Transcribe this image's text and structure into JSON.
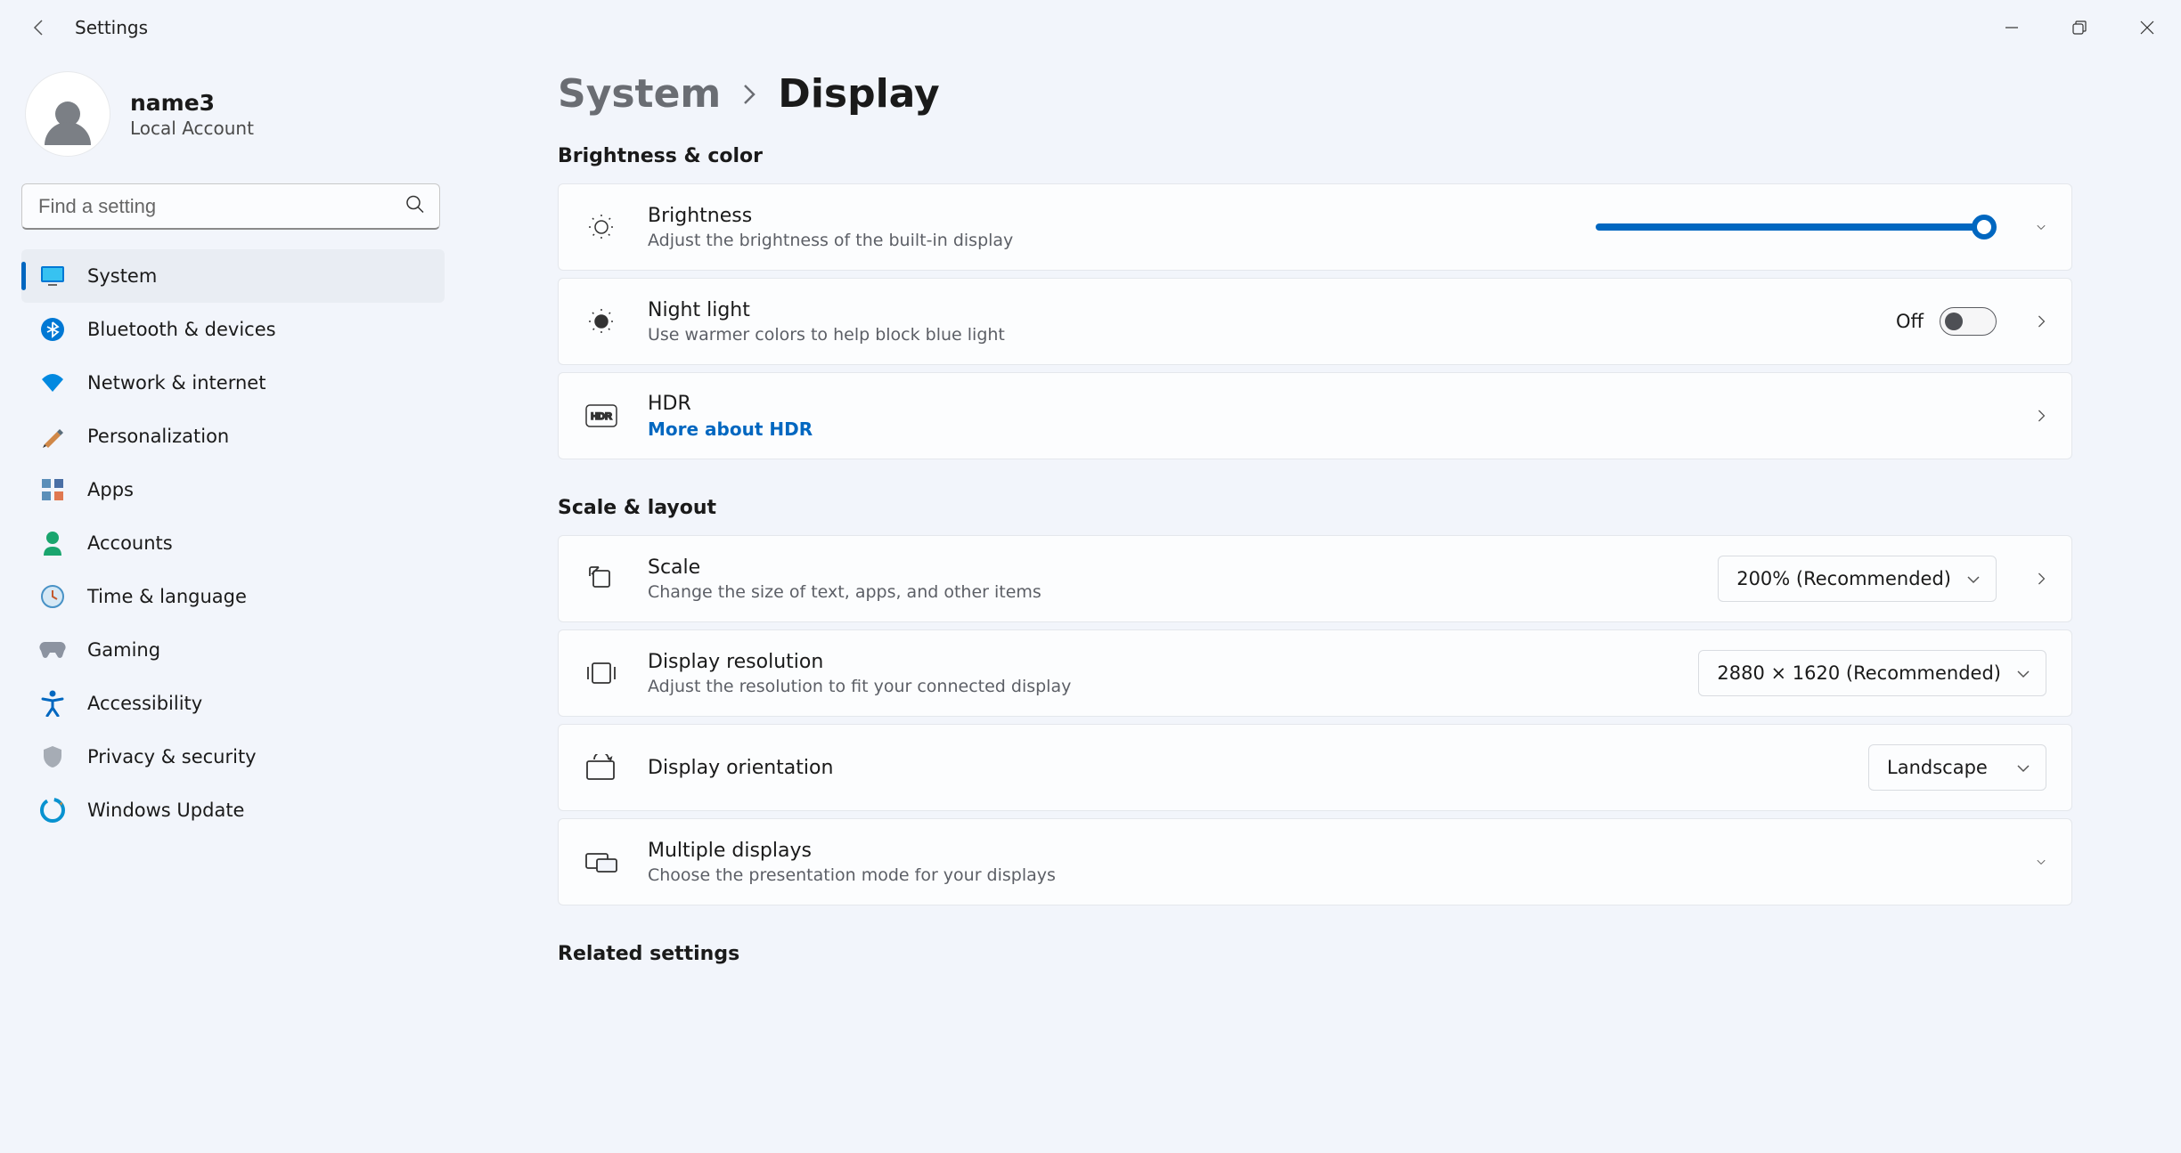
{
  "app_title": "Settings",
  "account": {
    "name": "name3",
    "sub": "Local Account"
  },
  "search": {
    "placeholder": "Find a setting"
  },
  "nav": {
    "system": "System",
    "bluetooth": "Bluetooth & devices",
    "network": "Network & internet",
    "personalization": "Personalization",
    "apps": "Apps",
    "accounts": "Accounts",
    "time": "Time & language",
    "gaming": "Gaming",
    "accessibility": "Accessibility",
    "privacy": "Privacy & security",
    "update": "Windows Update"
  },
  "breadcrumb": {
    "parent": "System",
    "current": "Display"
  },
  "sections": {
    "brightness_color": "Brightness & color",
    "scale_layout": "Scale & layout",
    "related": "Related settings"
  },
  "cards": {
    "brightness": {
      "title": "Brightness",
      "sub": "Adjust the brightness of the built-in display",
      "value": 100
    },
    "night_light": {
      "title": "Night light",
      "sub": "Use warmer colors to help block blue light",
      "state": "Off"
    },
    "hdr": {
      "title": "HDR",
      "link": "More about HDR"
    },
    "scale": {
      "title": "Scale",
      "sub": "Change the size of text, apps, and other items",
      "value": "200% (Recommended)"
    },
    "resolution": {
      "title": "Display resolution",
      "sub": "Adjust the resolution to fit your connected display",
      "value": "2880 × 1620 (Recommended)"
    },
    "orientation": {
      "title": "Display orientation",
      "value": "Landscape"
    },
    "multiple": {
      "title": "Multiple displays",
      "sub": "Choose the presentation mode for your displays"
    }
  }
}
